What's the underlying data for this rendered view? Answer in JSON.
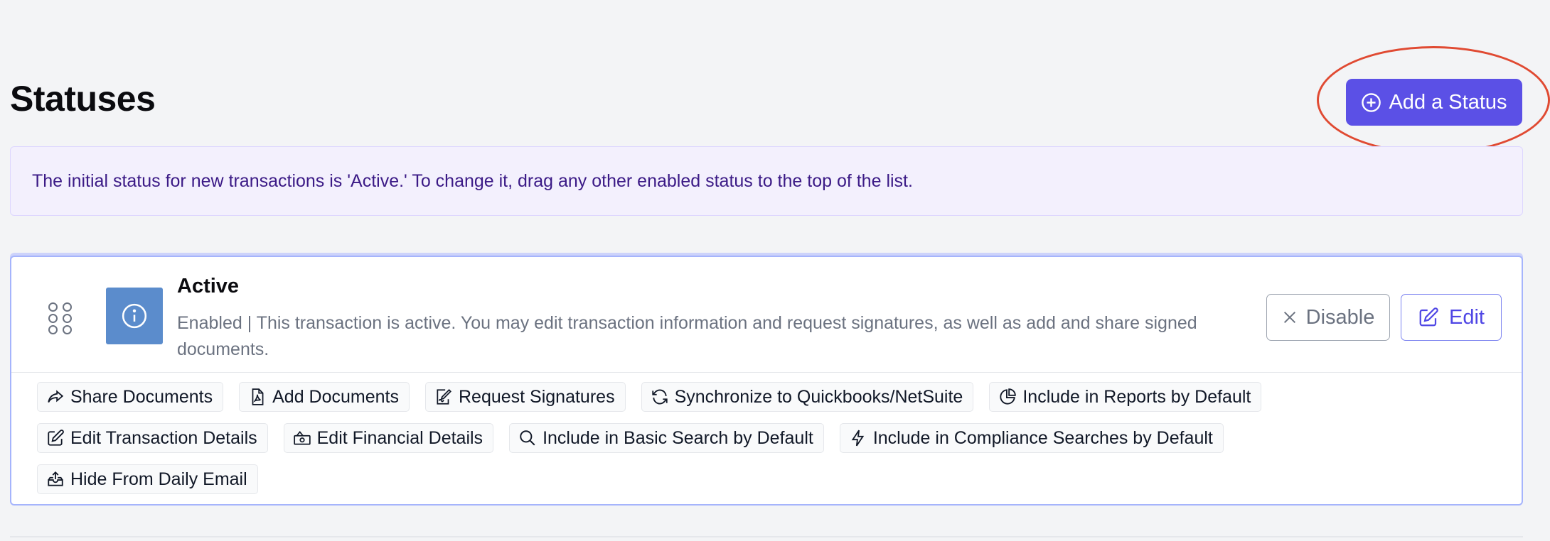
{
  "page": {
    "title": "Statuses",
    "add_button_label": "Add a Status",
    "info_message": "The initial status for new transactions is 'Active.' To change it, drag any other enabled status to the top of the list."
  },
  "colors": {
    "accent": "#5b50e6",
    "status_icon_bg": "#5b8ccc",
    "annotation": "#e04a32"
  },
  "status": {
    "name": "Active",
    "description": "Enabled | This transaction is active. You may edit transaction information and request signatures, as well as add and share signed documents.",
    "icon": "info-icon",
    "disable_label": "Disable",
    "edit_label": "Edit",
    "permissions": [
      {
        "label": "Share Documents",
        "icon": "share-icon"
      },
      {
        "label": "Add Documents",
        "icon": "pdf-file-icon"
      },
      {
        "label": "Request Signatures",
        "icon": "signature-icon"
      },
      {
        "label": "Synchronize to Quickbooks/NetSuite",
        "icon": "sync-icon"
      },
      {
        "label": "Include in Reports by Default",
        "icon": "pie-chart-icon"
      },
      {
        "label": "Edit Transaction Details",
        "icon": "edit-icon"
      },
      {
        "label": "Edit Financial Details",
        "icon": "money-icon"
      },
      {
        "label": "Include in Basic Search by Default",
        "icon": "search-icon"
      },
      {
        "label": "Include in Compliance Searches by Default",
        "icon": "bolt-icon"
      },
      {
        "label": "Hide From Daily Email",
        "icon": "inbox-upload-icon"
      }
    ]
  }
}
